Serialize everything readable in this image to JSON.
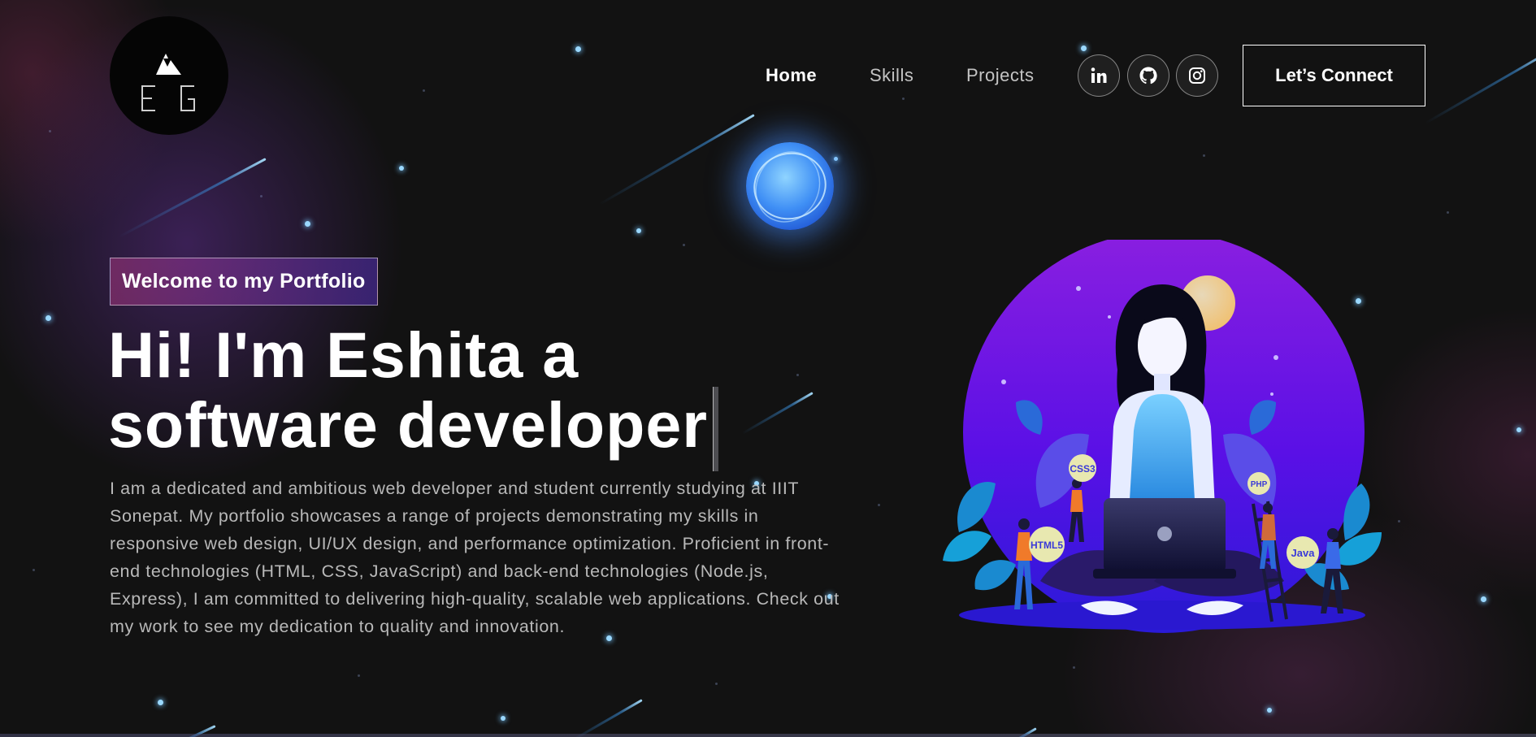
{
  "logo": {
    "initials": "E G"
  },
  "nav": {
    "links": [
      {
        "label": "Home",
        "active": true
      },
      {
        "label": "Skills",
        "active": false
      },
      {
        "label": "Projects",
        "active": false
      }
    ],
    "social": [
      {
        "name": "linkedin-icon",
        "glyph": "in"
      },
      {
        "name": "github-icon"
      },
      {
        "name": "instagram-icon"
      }
    ],
    "connect_label": "Let’s Connect"
  },
  "hero": {
    "tagline": "Welcome to my Portfolio",
    "headline_line1": "Hi! I'm Eshita a",
    "headline_line2": "software developer",
    "bio": "I am a dedicated and ambitious web developer and student currently studying at IIIT Sonepat. My portfolio showcases a range of projects demonstrating my skills in responsive web design, UI/UX design, and performance optimization. Proficient in front-end technologies (HTML, CSS, JavaScript) and back-end technologies (Node.js, Express), I am committed to delivering high-quality, scalable web applications. Check out my work to see my dedication to quality and innovation."
  },
  "illustration": {
    "badges": [
      "CSS3",
      "HTML5",
      "PHP",
      "Java"
    ]
  },
  "colors": {
    "background": "#121212",
    "accent_pink": "#aa367c",
    "accent_purple": "#4a2fbd",
    "star_blue": "#9ad8ff"
  }
}
